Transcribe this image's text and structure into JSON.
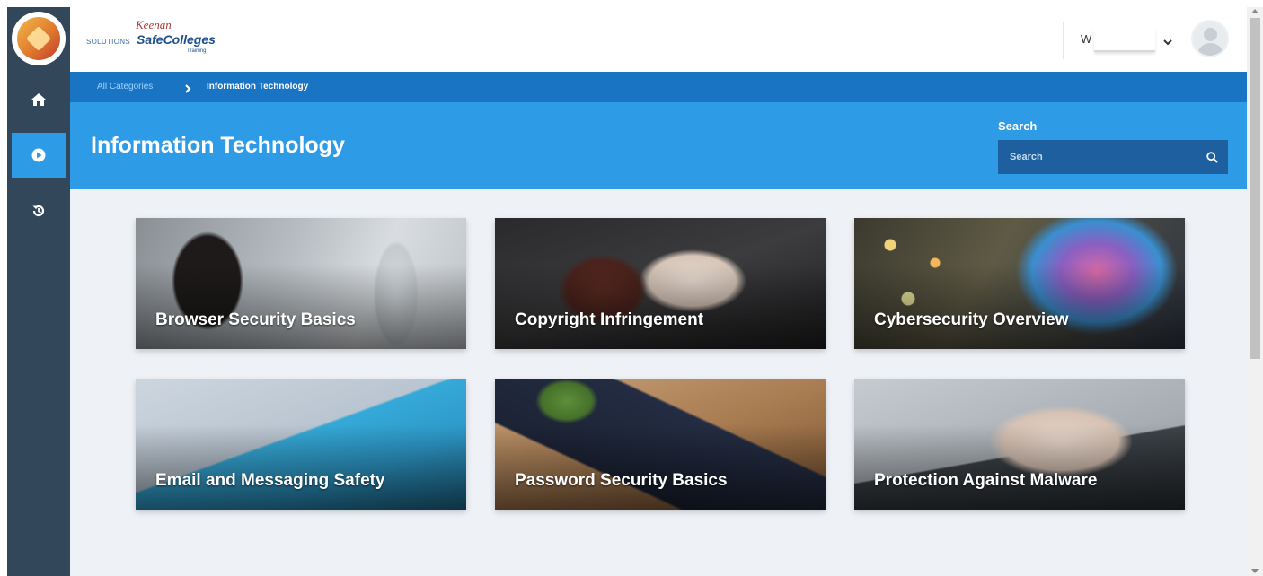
{
  "header": {
    "partner_text": "SOLUTIONS",
    "brand_script": "Keenan",
    "brand_name": "SafeColleges",
    "brand_sub": "Training",
    "user_initial": "W"
  },
  "sidebar": {
    "items": [
      {
        "name": "home",
        "icon": "home-icon"
      },
      {
        "name": "courses",
        "icon": "play-circle-icon",
        "active": true
      },
      {
        "name": "history",
        "icon": "history-icon"
      }
    ]
  },
  "breadcrumb": {
    "root": "All Categories",
    "current": "Information Technology"
  },
  "category": {
    "title": "Information Technology"
  },
  "search": {
    "label": "Search",
    "placeholder": "Search"
  },
  "courses": [
    {
      "title": "Browser Security Basics"
    },
    {
      "title": "Copyright Infringement"
    },
    {
      "title": "Cybersecurity Overview"
    },
    {
      "title": "Email and Messaging Safety"
    },
    {
      "title": "Password Security Basics"
    },
    {
      "title": "Protection Against Malware"
    }
  ],
  "colors": {
    "sidebar": "#33475b",
    "accent": "#2e9be6",
    "breadcrumb_bar": "#1a74c4",
    "search_box": "#1d5f9f",
    "content_bg": "#eef1f6"
  }
}
